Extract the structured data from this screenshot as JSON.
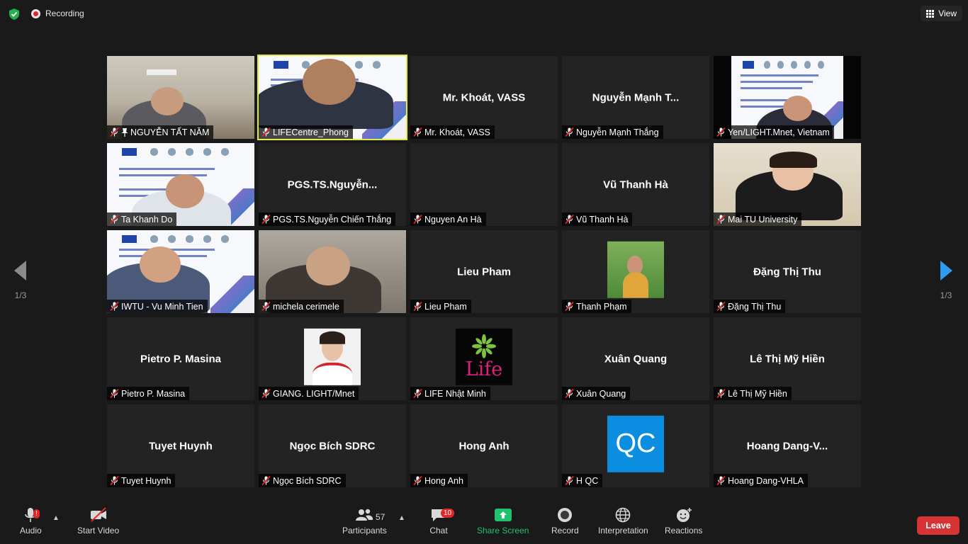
{
  "topbar": {
    "recording_label": "Recording",
    "view_label": "View"
  },
  "nav": {
    "page_indicator": "1/3"
  },
  "tiles": [
    {
      "title": "",
      "label": "NGUYỄN TẤT NĂM",
      "pinned": true,
      "video": "room"
    },
    {
      "title": "",
      "label": "LIFECentre_Phong",
      "pinned": false,
      "video": "slide-man",
      "active": true
    },
    {
      "title": "Mr. Khoát, VASS",
      "label": "Mr. Khoát, VASS",
      "pinned": false,
      "video": "none"
    },
    {
      "title": "Nguyễn Mạnh T...",
      "label": "Nguyễn Mạnh Thắng",
      "pinned": false,
      "video": "none"
    },
    {
      "title": "",
      "label": "Yen/LIGHT.Mnet, Vietnam",
      "pinned": false,
      "video": "slide-woman"
    },
    {
      "title": "",
      "label": "Ta Khanh Do",
      "pinned": false,
      "video": "slide-man2"
    },
    {
      "title": "PGS.TS.Nguyễn...",
      "label": "PGS.TS.Nguyễn Chiến Thắng",
      "pinned": false,
      "video": "none"
    },
    {
      "title": "",
      "label": "Nguyen An Hà",
      "pinned": false,
      "video": "none"
    },
    {
      "title": "Vũ Thanh Hà",
      "label": "Vũ Thanh Hà",
      "pinned": false,
      "video": "none"
    },
    {
      "title": "",
      "label": "Mai TU University",
      "pinned": false,
      "video": "woman"
    },
    {
      "title": "",
      "label": "IWTU - Vu Minh Tien",
      "pinned": false,
      "video": "slide-man3"
    },
    {
      "title": "",
      "label": "michela cerimele",
      "pinned": false,
      "video": "grey"
    },
    {
      "title": "Lieu Pham",
      "label": "Lieu Pham",
      "pinned": false,
      "video": "none"
    },
    {
      "title": "",
      "label": "Thanh Phạm",
      "pinned": false,
      "video": "avatar-leaf"
    },
    {
      "title": "Đặng Thị Thu",
      "label": "Đặng Thị Thu",
      "pinned": false,
      "video": "none"
    },
    {
      "title": "Pietro P. Masina",
      "label": "Pietro P. Masina",
      "pinned": false,
      "video": "none"
    },
    {
      "title": "",
      "label": "GIANG. LIGHT/Mnet",
      "pinned": false,
      "video": "avatar-portrait"
    },
    {
      "title": "",
      "label": "LIFE Nhật Minh",
      "pinned": false,
      "video": "avatar-life",
      "avatar_text": "Life"
    },
    {
      "title": "Xuân Quang",
      "label": "Xuân Quang",
      "pinned": false,
      "video": "none"
    },
    {
      "title": "Lê Thị Mỹ Hiền",
      "label": "Lê Thị Mỹ Hiền",
      "pinned": false,
      "video": "none"
    },
    {
      "title": "Tuyet Huynh",
      "label": "Tuyet Huynh",
      "pinned": false,
      "video": "none"
    },
    {
      "title": "Ngọc Bích SDRC",
      "label": "Ngọc Bích SDRC",
      "pinned": false,
      "video": "none"
    },
    {
      "title": "Hong Anh",
      "label": "Hong Anh",
      "pinned": false,
      "video": "none"
    },
    {
      "title": "",
      "label": "H QC",
      "pinned": false,
      "video": "avatar-qc",
      "avatar_text": "QC"
    },
    {
      "title": "Hoang  Dang-V...",
      "label": "Hoang Dang-VHLA",
      "pinned": false,
      "video": "none"
    }
  ],
  "toolbar": {
    "audio_label": "Audio",
    "video_label": "Start Video",
    "participants_label": "Participants",
    "participants_count": "57",
    "chat_label": "Chat",
    "chat_badge": "10",
    "share_label": "Share Screen",
    "record_label": "Record",
    "interpretation_label": "Interpretation",
    "reactions_label": "Reactions",
    "leave_label": "Leave"
  },
  "colors": {
    "active_border": "#e0e84a",
    "share_green": "#20c26b",
    "leave_red": "#d63434",
    "badge_red": "#e02828"
  }
}
